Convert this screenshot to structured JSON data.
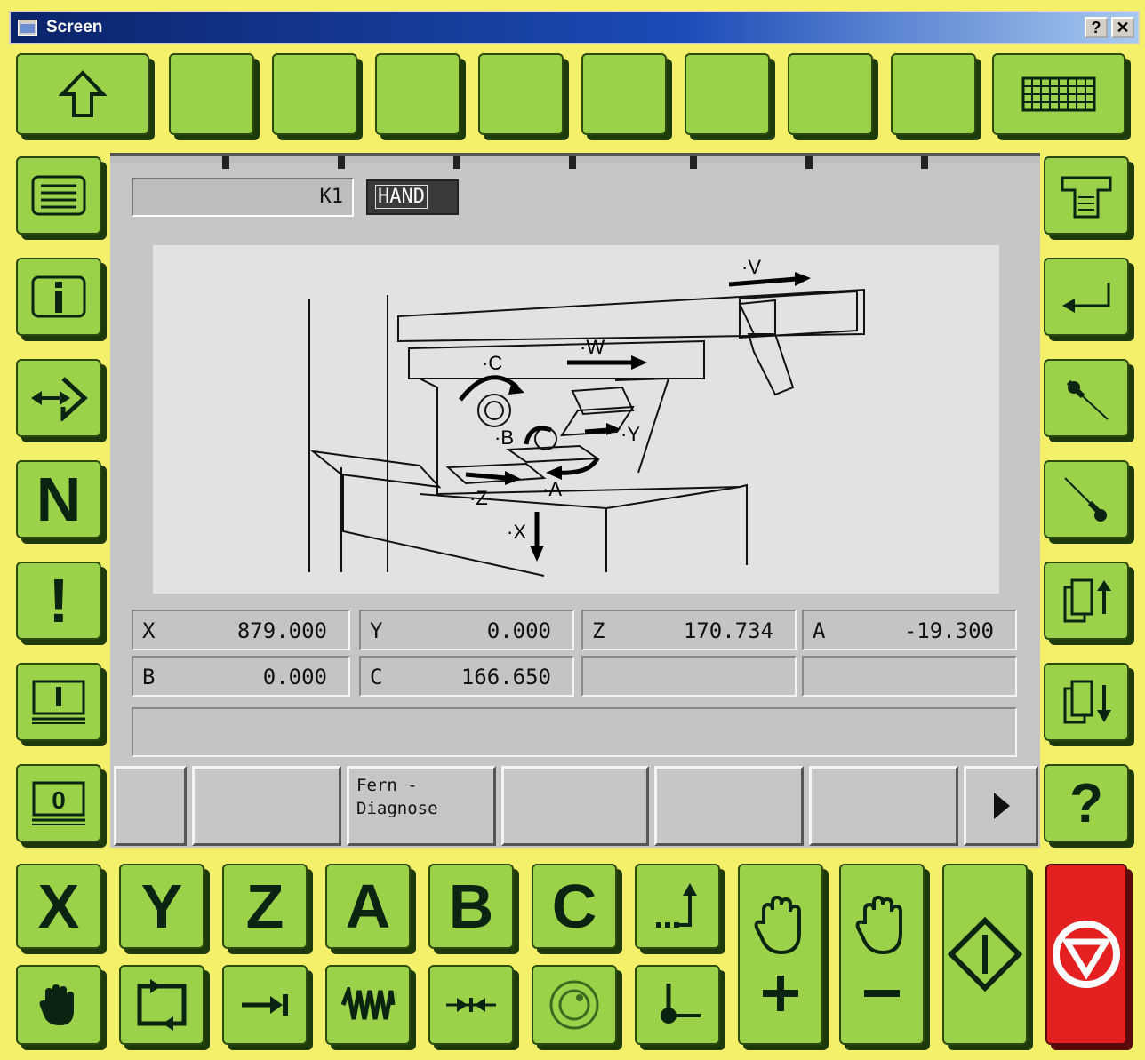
{
  "window": {
    "title": "Screen",
    "help_button": "?",
    "close_button": "✕"
  },
  "status": {
    "channel": "K1",
    "mode": "HAND"
  },
  "axes": [
    {
      "name": "X",
      "value": "879.000"
    },
    {
      "name": "Y",
      "value": "0.000"
    },
    {
      "name": "Z",
      "value": "170.734"
    },
    {
      "name": "A",
      "value": "-19.300"
    },
    {
      "name": "B",
      "value": "0.000"
    },
    {
      "name": "C",
      "value": "166.650"
    },
    {
      "name": "",
      "value": ""
    },
    {
      "name": "",
      "value": ""
    }
  ],
  "machine_diagram": {
    "labels": [
      "·V",
      "·W",
      "·C",
      "·B",
      "·Y",
      "·Z",
      "·A",
      "·X"
    ]
  },
  "softkeys": [
    "",
    "",
    "Fern -\nDiagnose",
    "",
    "",
    ""
  ],
  "left_keys": [
    "menu-icon",
    "i",
    "jog-icon",
    "N",
    "!",
    "reference-point-icon",
    "0"
  ],
  "right_keys": [
    "printer-icon",
    "enter-icon",
    "pin-icon",
    "pin-down-icon",
    "page-up-icon",
    "page-down-icon",
    "?"
  ],
  "axis_keys": [
    "X",
    "Y",
    "Z",
    "A",
    "B",
    "C"
  ],
  "bottom_help": "?",
  "colors": {
    "key_green": "#9bd24a",
    "window_bg": "#f4f06a",
    "stop_red": "#e42020",
    "panel_gray": "#c6c6c6"
  }
}
